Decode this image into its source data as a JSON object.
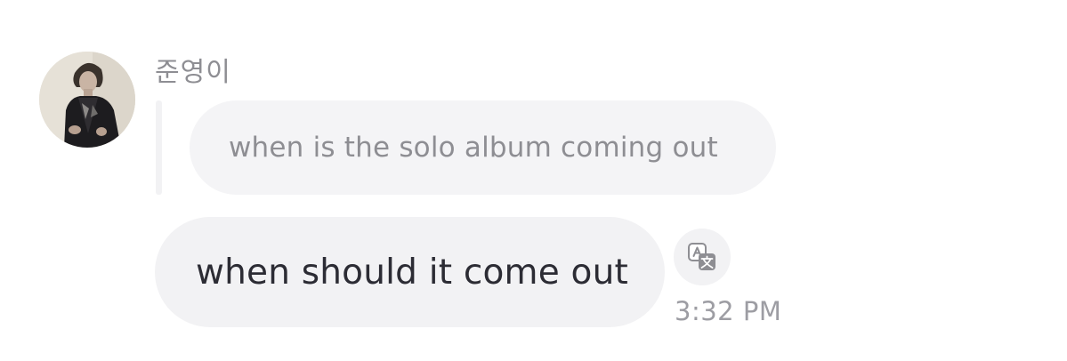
{
  "message": {
    "sender_name": "준영이",
    "avatar_icon": "profile-photo",
    "quoted_reply": "when is the solo album coming out",
    "text": "when should it come out",
    "timestamp": "3:32 PM",
    "translate_icon": "translate-icon"
  },
  "colors": {
    "bubble_background": "#f2f2f4",
    "quoted_text": "#8e8e93",
    "message_text": "#2c2c34",
    "timestamp": "#9d9da3"
  }
}
